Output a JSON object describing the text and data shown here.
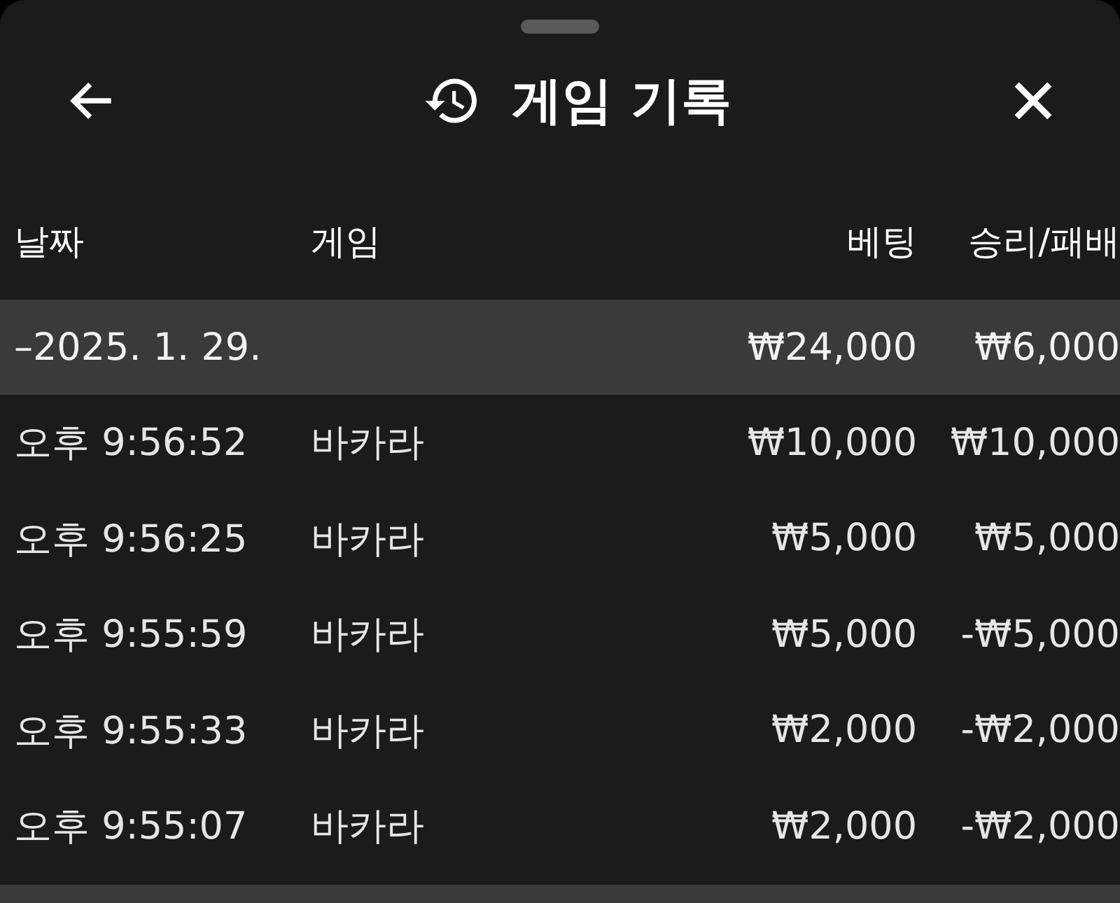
{
  "header": {
    "title": "게임 기록"
  },
  "table": {
    "columns": [
      "날짜",
      "게임",
      "베팅",
      "승리/패배"
    ],
    "groups": [
      {
        "toggle": "–",
        "date": "2025. 1. 29.",
        "bet_total": "₩24,000",
        "result_total": "₩6,000",
        "rows": [
          {
            "time": "오후 9:56:52",
            "game": "바카라",
            "bet": "₩10,000",
            "result": "₩10,000"
          },
          {
            "time": "오후 9:56:25",
            "game": "바카라",
            "bet": "₩5,000",
            "result": "₩5,000"
          },
          {
            "time": "오후 9:55:59",
            "game": "바카라",
            "bet": "₩5,000",
            "result": "-₩5,000"
          },
          {
            "time": "오후 9:55:33",
            "game": "바카라",
            "bet": "₩2,000",
            "result": "-₩2,000"
          },
          {
            "time": "오후 9:55:07",
            "game": "바카라",
            "bet": "₩2,000",
            "result": "-₩2,000"
          }
        ]
      }
    ]
  }
}
